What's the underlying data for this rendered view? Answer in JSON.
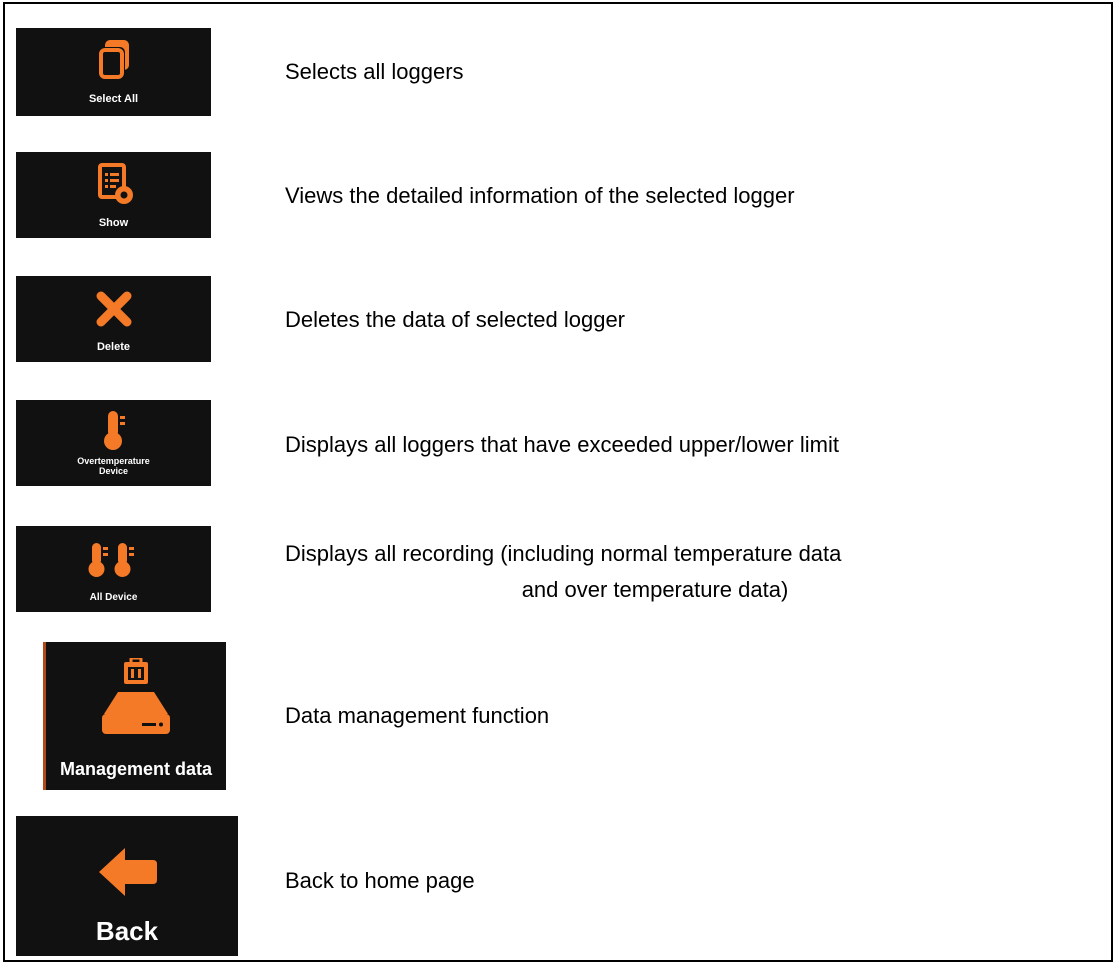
{
  "rows": [
    {
      "button_label": "Select All",
      "icon": "select-all-icon",
      "description": "Selects all loggers"
    },
    {
      "button_label": "Show",
      "icon": "show-icon",
      "description": "Views the detailed information of the selected logger"
    },
    {
      "button_label": "Delete",
      "icon": "delete-icon",
      "description": "Deletes the data of selected logger"
    },
    {
      "button_label_line1": "Overtemperature",
      "button_label_line2": "Device",
      "icon": "thermometer-icon",
      "description": "Displays all loggers that have exceeded upper/lower limit"
    },
    {
      "button_label": "All Device",
      "icon": "two-thermometers-icon",
      "description_line1": "Displays all recording (including normal temperature data",
      "description_line2": "and over temperature data)"
    },
    {
      "button_label": "Management data",
      "icon": "data-management-icon",
      "description": "Data management function"
    },
    {
      "button_label": "Back",
      "icon": "back-arrow-icon",
      "description": "Back to home page"
    }
  ],
  "colors": {
    "accent": "#f47a28",
    "button_bg": "#111111",
    "label": "#ffffff"
  }
}
